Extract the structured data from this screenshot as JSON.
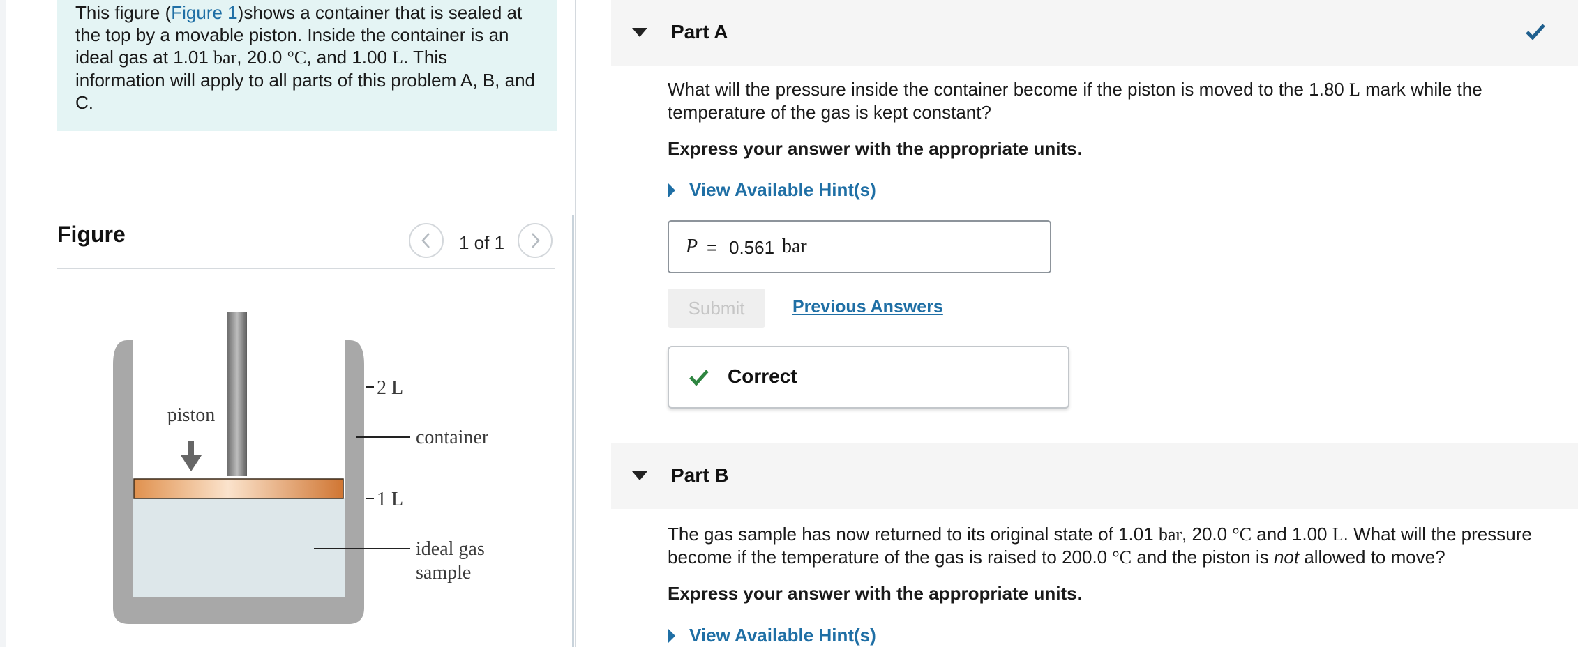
{
  "intro": {
    "line1_pre": "This figure (",
    "figure_link": "Figure 1",
    "line1_post": ")shows a container that is sealed at",
    "line2": "the top by a movable piston. Inside the container is an",
    "line3_pre": "ideal gas at 1.01 ",
    "line3_u1": "bar",
    "line3_mid1": ", 20.0 ",
    "line3_u2": "°C",
    "line3_mid2": ", and 1.00 ",
    "line3_u3": "L",
    "line3_post": ". This",
    "line4": "information will apply to all parts of this problem A, B, and",
    "line5": "C."
  },
  "figure": {
    "title": "Figure",
    "counter": "1 of 1",
    "labels": {
      "piston": "piston",
      "two_l": "2 L",
      "one_l": "1 L",
      "container": "container",
      "gas_line1": "ideal gas",
      "gas_line2": "sample"
    }
  },
  "part_a": {
    "title": "Part A",
    "question_line1_pre": "What will the pressure inside the container become if the piston is moved to the 1.80 ",
    "question_unit": "L",
    "question_line1_post": " mark while the",
    "question_line2": "temperature of the gas is kept constant?",
    "instruction": "Express your answer with the appropriate units.",
    "hint": "View Available Hint(s)",
    "answer_var": "P",
    "answer_eq": "=",
    "answer_value": "0.561",
    "answer_unit": "bar",
    "submit": "Submit",
    "previous": "Previous Answers",
    "feedback": "Correct"
  },
  "part_b": {
    "title": "Part B",
    "line1_pre": "The gas sample has now returned to its original state of 1.01 ",
    "u1": "bar",
    "mid1": ", 20.0 ",
    "u2": "°C",
    "mid2": " and 1.00 ",
    "u3": "L",
    "line1_post": ". What will the pressure",
    "line2_pre": "become if the temperature of the gas is raised to 200.0 ",
    "u4": "°C",
    "line2_mid": " and the piston is ",
    "line2_em": "not",
    "line2_post": " allowed to move?",
    "instruction": "Express your answer with the appropriate units.",
    "hint": "View Available Hint(s)"
  },
  "colors": {
    "link": "#1f6fa5",
    "intro_bg": "#e4f4f4",
    "correct_green": "#2e8540",
    "piston_orange": "#d9843f",
    "gas_fill": "#dde7ea",
    "container_gray": "#a8a8a8"
  }
}
